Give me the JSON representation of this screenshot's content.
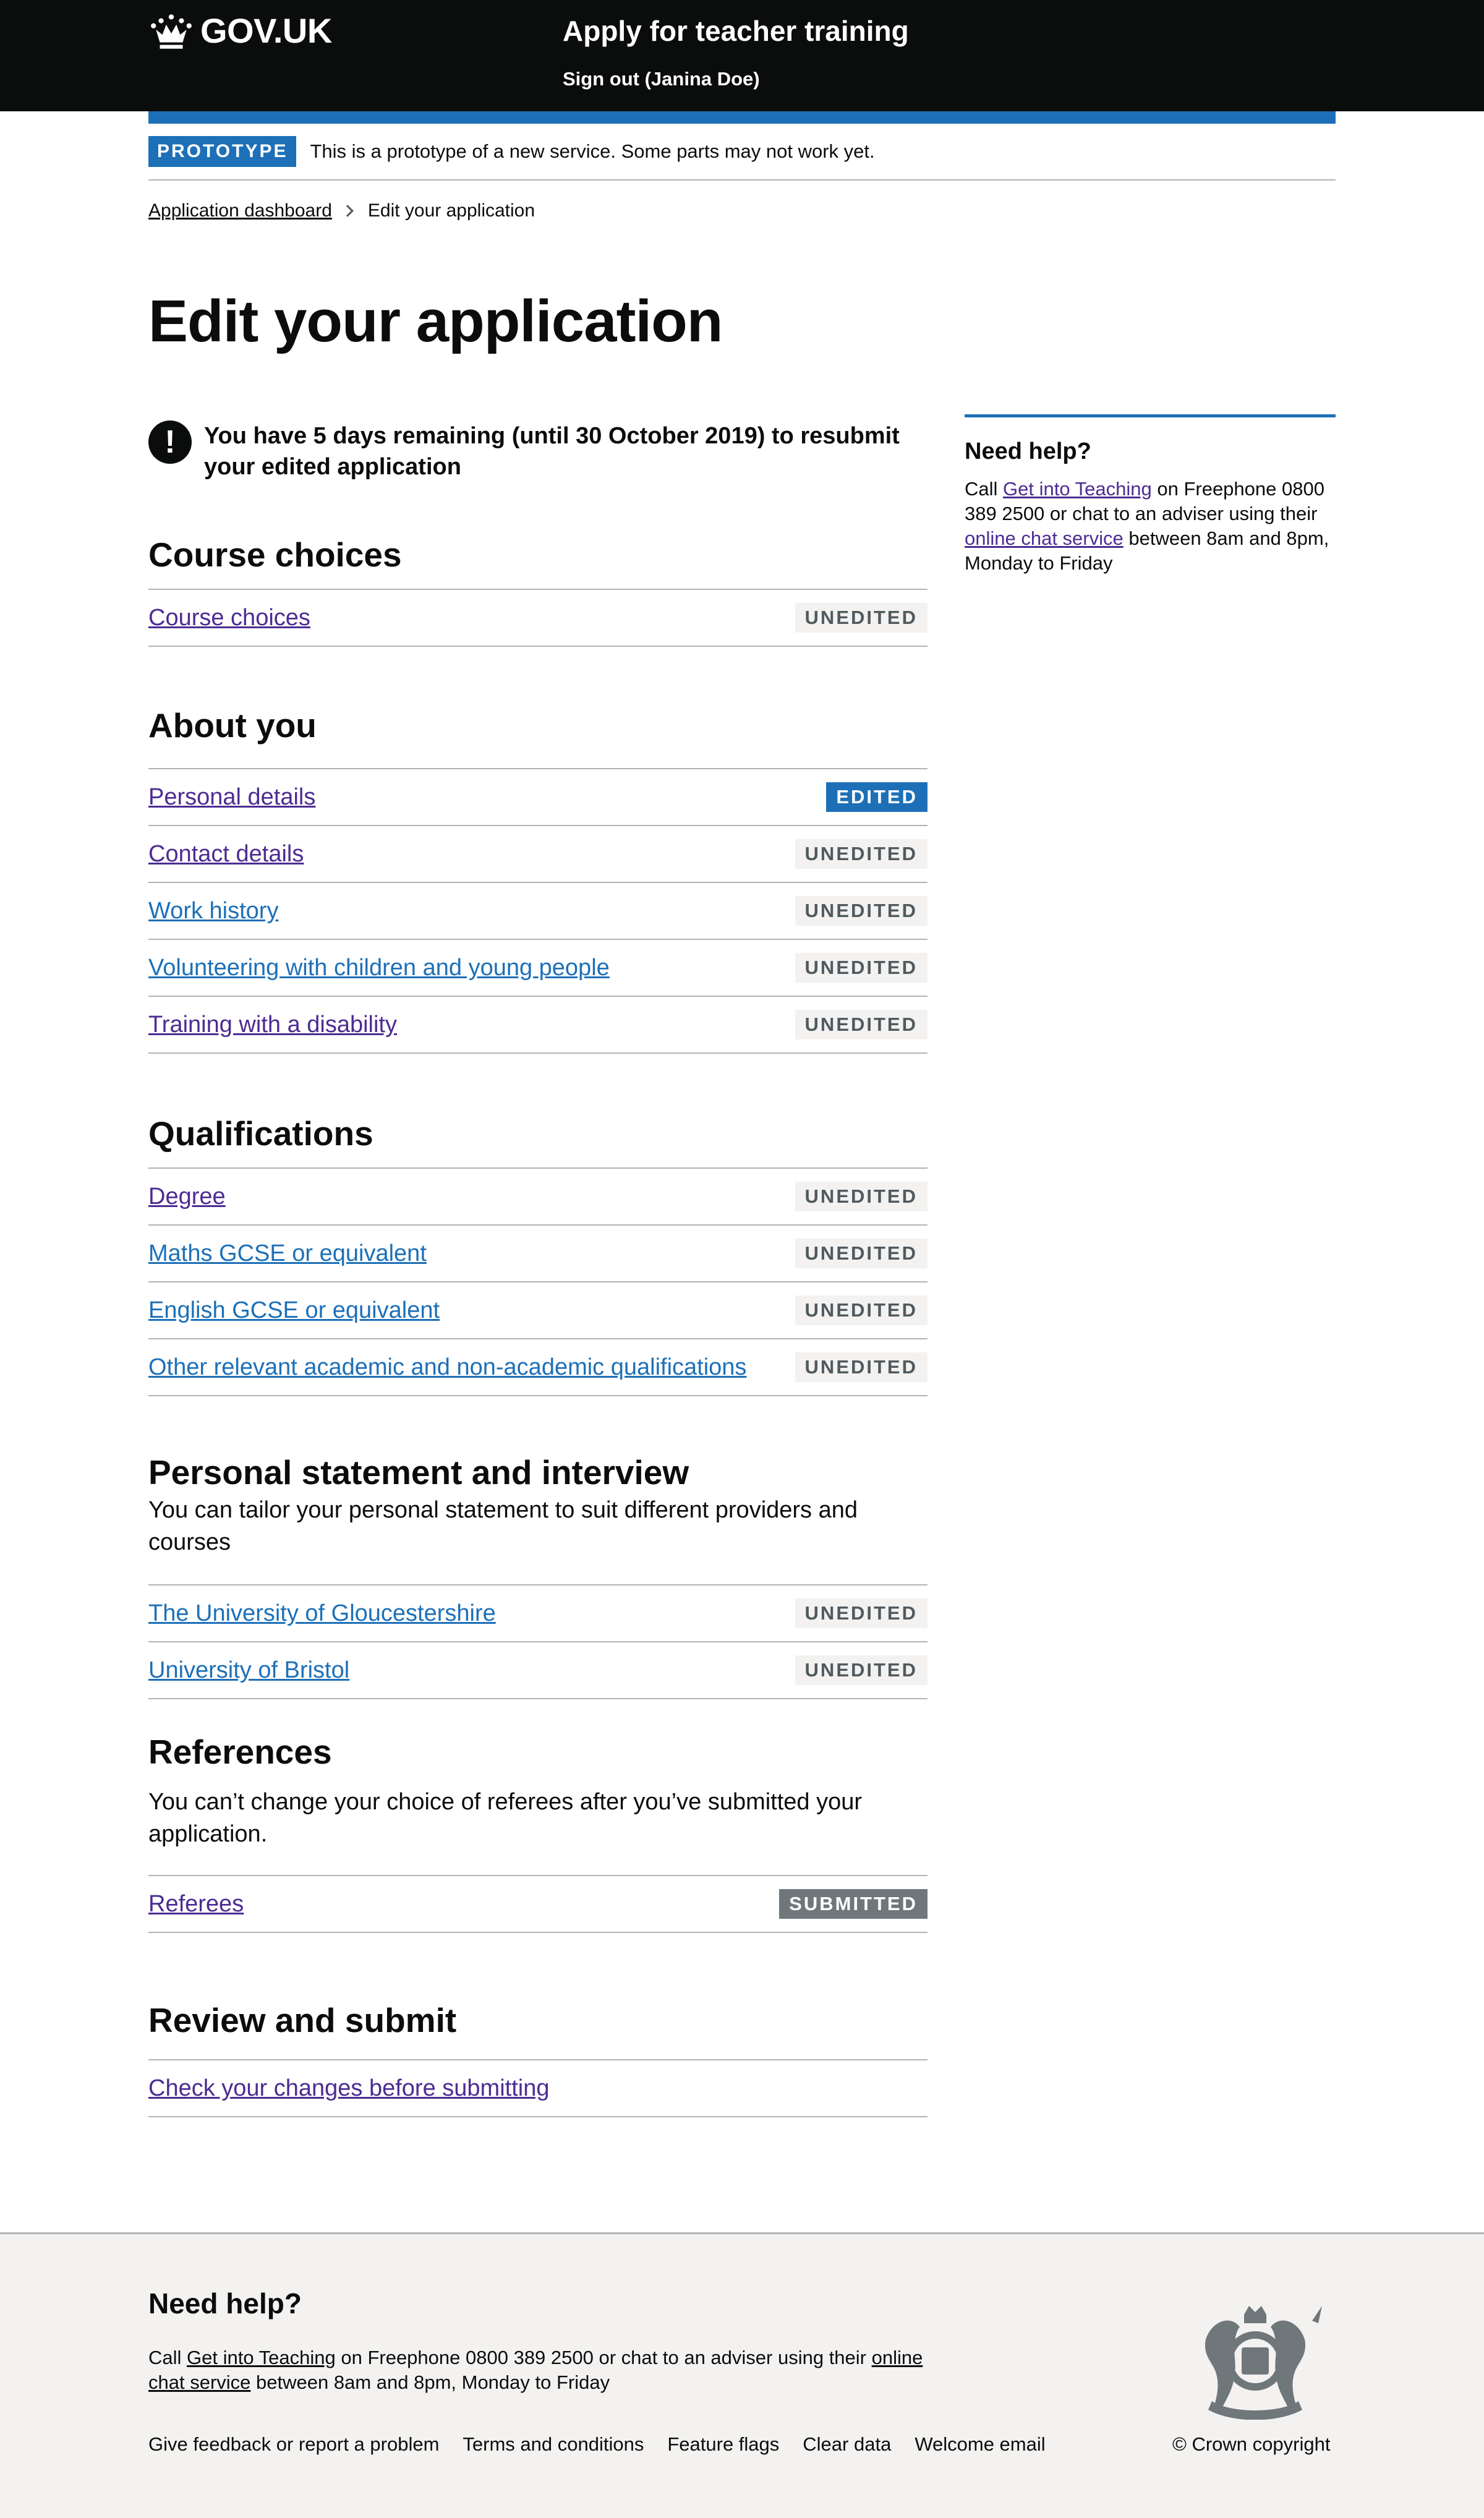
{
  "header": {
    "logo_text": "GOV.UK",
    "service_name": "Apply for teacher training",
    "sign_out": "Sign out (Janina Doe)"
  },
  "phase_banner": {
    "tag": "PROTOTYPE",
    "text": "This is a prototype of a new service. Some parts may not work yet."
  },
  "breadcrumb": {
    "items": [
      "Application dashboard",
      "Edit your application"
    ]
  },
  "page_title": "Edit your application",
  "warning": {
    "icon": "!",
    "text": "You have 5 days remaining (until 30 October 2019) to resubmit your edited application"
  },
  "sections": [
    {
      "title": "Course choices",
      "items": [
        {
          "label": "Course choices",
          "status": "UNEDITED"
        }
      ]
    },
    {
      "title": "About you",
      "items": [
        {
          "label": "Personal details",
          "status": "EDITED"
        },
        {
          "label": "Contact details",
          "status": "UNEDITED"
        },
        {
          "label": "Work history",
          "status": "UNEDITED"
        },
        {
          "label": "Volunteering with children and young people",
          "status": "UNEDITED"
        },
        {
          "label": "Training with a disability",
          "status": "UNEDITED"
        }
      ]
    },
    {
      "title": "Qualifications",
      "items": [
        {
          "label": "Degree",
          "status": "UNEDITED"
        },
        {
          "label": "Maths GCSE or equivalent",
          "status": "UNEDITED"
        },
        {
          "label": "English GCSE or equivalent",
          "status": "UNEDITED"
        },
        {
          "label": "Other relevant academic and non-academic qualifications",
          "status": "UNEDITED"
        }
      ]
    },
    {
      "title": "Personal statement and interview",
      "description": "You can tailor your personal statement to suit different providers and courses",
      "items": [
        {
          "label": "The University of Gloucestershire",
          "status": "UNEDITED"
        },
        {
          "label": "University of Bristol",
          "status": "UNEDITED"
        }
      ]
    },
    {
      "title": "References",
      "description": "You can’t change your choice of referees after you’ve submitted your application.",
      "items": [
        {
          "label": "Referees",
          "status": "SUBMITTED"
        }
      ]
    },
    {
      "title": "Review and submit",
      "items": [
        {
          "label": "Check your changes before submitting"
        }
      ]
    }
  ],
  "sidebar": {
    "title": "Need help?",
    "text_1": "Call ",
    "link_1": "Get into Teaching",
    "text_2": " on Freephone 0800 389 2500 or chat to an adviser using their ",
    "link_2": "online chat service",
    "text_3": " between 8am and 8pm, Monday to Friday"
  },
  "footer": {
    "title": "Need help?",
    "text_1": "Call ",
    "link_1": "Get into Teaching",
    "text_2": " on Freephone 0800 389 2500 or chat to an adviser using their ",
    "link_2": "online chat service",
    "text_3": " between 8am and 8pm, Monday to Friday",
    "links": [
      "Give feedback or report a problem",
      "Terms and conditions",
      "Feature flags",
      "Clear data",
      "Welcome email"
    ],
    "copyright": "© Crown copyright"
  },
  "colors": {
    "header_bg": "#0b0c0c",
    "brand_blue": "#1d70b8",
    "visited_link": "#4c2c92",
    "footer_bg": "#f3f2f1"
  }
}
